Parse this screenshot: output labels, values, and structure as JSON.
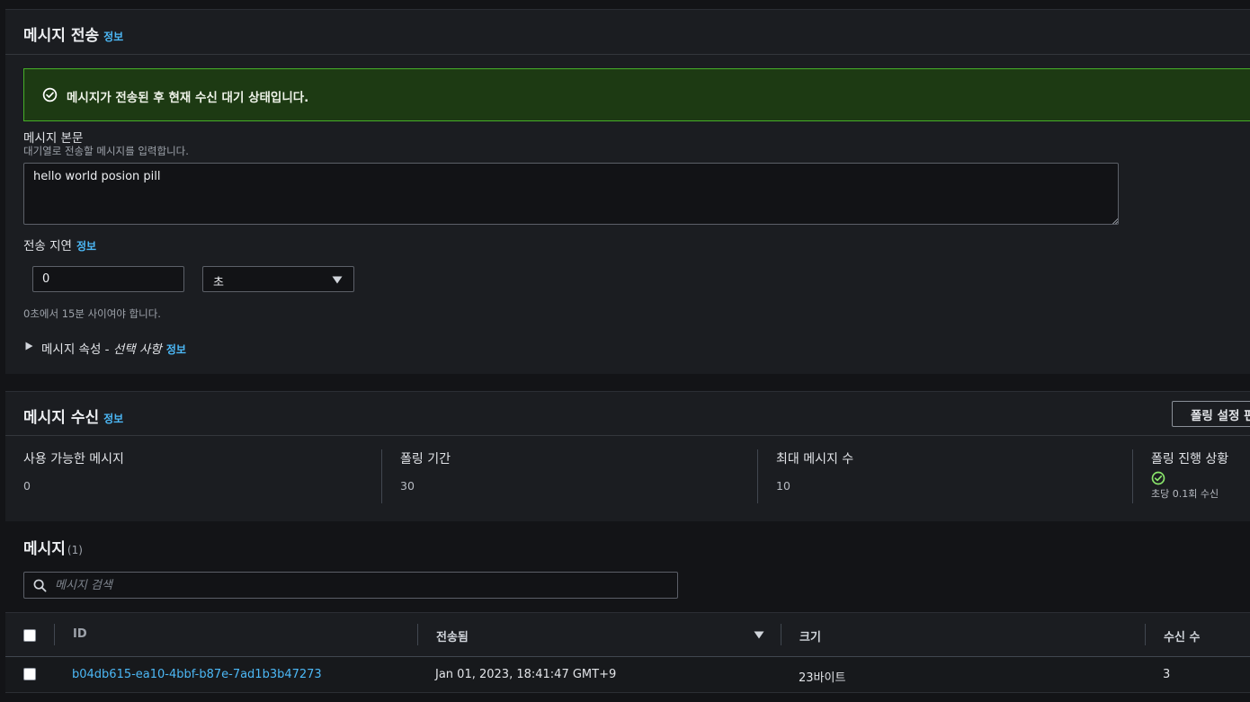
{
  "send": {
    "title": "메시지 전송",
    "info": "정보",
    "flash": "메시지가 전송된 후 현재 수신 대기 상태입니다.",
    "body_label": "메시지 본문",
    "body_desc": "대기열로 전송할 메시지를 입력합니다.",
    "body_value": "hello world posion pill",
    "delay_label": "전송 지연",
    "delay_info": "정보",
    "delay_value": "0",
    "delay_unit": "초",
    "delay_hint": "0초에서 15분 사이여야 합니다.",
    "attributes_label": "메시지 속성 - ",
    "attributes_optional": "선택 사항",
    "attributes_info": "정보"
  },
  "receive": {
    "title": "메시지 수신",
    "info": "정보",
    "poll_settings_button": "폴링 설정 편",
    "stats": [
      {
        "label": "사용 가능한 메시지",
        "value": "0"
      },
      {
        "label": "폴링 기간",
        "value": "30"
      },
      {
        "label": "최대 메시지 수",
        "value": "10"
      }
    ],
    "poll_progress_label": "폴링 진행 상황",
    "poll_progress_icon": "check-circle-icon",
    "poll_progress_note": "초당 0.1회 수신"
  },
  "messages": {
    "title": "메시지",
    "count": "(1)",
    "search_placeholder": "메시지 검색",
    "columns": {
      "id": "ID",
      "sent": "전송됨",
      "size": "크기",
      "receive_count": "수신 수"
    },
    "rows": [
      {
        "id": "b04db615-ea10-4bbf-b87e-7ad1b3b47273",
        "sent": "Jan 01, 2023, 18:41:47 GMT+9",
        "size": "23바이트",
        "receive_count": "3"
      }
    ]
  },
  "colors": {
    "success": "#46b028",
    "link": "#4cb8f6",
    "background": "#131417",
    "panel": "#1b1d21"
  }
}
